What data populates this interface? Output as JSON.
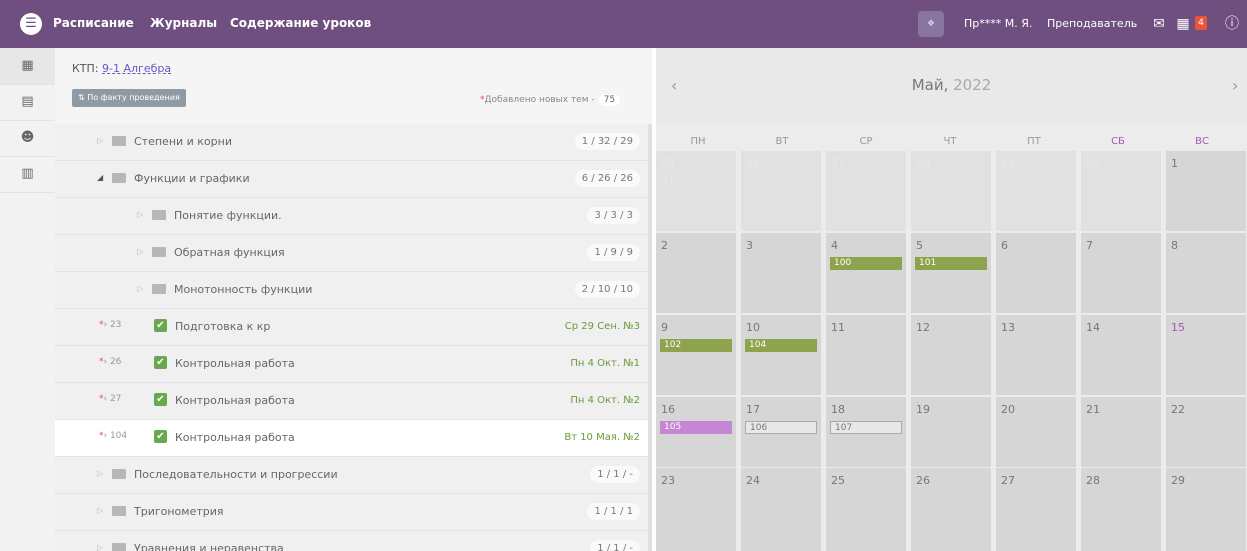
{
  "topbar": {
    "menu_icon": "hamburger-icon",
    "nav": [
      "Расписание",
      "Журналы",
      "Содержание уроков"
    ],
    "user_name": "Пр**** М. Я.",
    "user_role": "Преподаватель",
    "notifications_count": "4",
    "icons": [
      "mail-icon",
      "calendar-icon",
      "info-icon"
    ]
  },
  "siderail": {
    "icons": [
      "calendar-icon",
      "document-icon",
      "users-icon",
      "map-icon"
    ]
  },
  "left": {
    "ktp_label": "КТП:",
    "ktp_link": "9-1 Алгебра",
    "filter_button": "По факту проведения",
    "new_topics_star": "*",
    "new_topics_label": "Добавлено новых тем -",
    "new_topics_count": "75",
    "rows": [
      {
        "type": "folder",
        "level": 1,
        "expanded": false,
        "label": "Степени и корни",
        "stats": "1 / 32 / 29"
      },
      {
        "type": "folder",
        "level": 1,
        "expanded": true,
        "label": "Функции и графики",
        "stats": "6 / 26 / 26"
      },
      {
        "type": "folder",
        "level": 2,
        "expanded": false,
        "label": "Понятие функции.",
        "stats": "3 / 3 / 3"
      },
      {
        "type": "folder",
        "level": 2,
        "expanded": false,
        "label": "Обратная функция",
        "stats": "1 / 9 / 9"
      },
      {
        "type": "folder",
        "level": 2,
        "expanded": false,
        "label": "Монотонность функции",
        "stats": "2 / 10 / 10"
      },
      {
        "type": "lesson",
        "num": "23",
        "label": "Подготовка к кр",
        "date": "Ср 29 Сен. №3"
      },
      {
        "type": "lesson",
        "num": "26",
        "label": "Контрольная работа",
        "date": "Пн 4 Окт. №1"
      },
      {
        "type": "lesson",
        "num": "27",
        "label": "Контрольная работа",
        "date": "Пн 4 Окт. №2"
      },
      {
        "type": "lesson",
        "num": "104",
        "label": "Контрольная работа",
        "date": "Вт 10 Мая. №2",
        "selected": true
      },
      {
        "type": "folder",
        "level": 1,
        "expanded": false,
        "label": "Последовательности и прогрессии",
        "stats": "1 / 1 / -"
      },
      {
        "type": "folder",
        "level": 1,
        "expanded": false,
        "label": "Тригонометрия",
        "stats": "1 / 1 / 1"
      },
      {
        "type": "folder",
        "level": 1,
        "expanded": false,
        "label": "Уравнения и неравенства",
        "stats": "1 / 1 / -"
      }
    ]
  },
  "calendar": {
    "month": "Май,",
    "year": "2022",
    "weekdays": [
      "ПН",
      "ВТ",
      "СР",
      "ЧТ",
      "ПТ",
      "СБ",
      "ВС"
    ],
    "weeks": [
      [
        {
          "d": "25",
          "muted": true,
          "extra": "31"
        },
        {
          "d": "26",
          "muted": true
        },
        {
          "d": "27",
          "muted": true
        },
        {
          "d": "28",
          "muted": true
        },
        {
          "d": "29",
          "muted": true
        },
        {
          "d": "30",
          "muted": true
        },
        {
          "d": "1"
        }
      ],
      [
        {
          "d": "2"
        },
        {
          "d": "3"
        },
        {
          "d": "4",
          "lesson": "100",
          "style": "green"
        },
        {
          "d": "5",
          "lesson": "101",
          "style": "green"
        },
        {
          "d": "6"
        },
        {
          "d": "7"
        },
        {
          "d": "8"
        }
      ],
      [
        {
          "d": "9",
          "lesson": "102",
          "style": "green"
        },
        {
          "d": "10",
          "lesson": "104",
          "style": "green"
        },
        {
          "d": "11"
        },
        {
          "d": "12"
        },
        {
          "d": "13"
        },
        {
          "d": "14"
        },
        {
          "d": "15",
          "weekend": true
        }
      ],
      [
        {
          "d": "16",
          "lesson": "105",
          "style": "purple"
        },
        {
          "d": "17",
          "lesson": "106",
          "style": "gray"
        },
        {
          "d": "18",
          "lesson": "107",
          "style": "gray"
        },
        {
          "d": "19"
        },
        {
          "d": "20"
        },
        {
          "d": "21"
        },
        {
          "d": "22"
        }
      ],
      [
        {
          "d": "23"
        },
        {
          "d": "24"
        },
        {
          "d": "25"
        },
        {
          "d": "26"
        },
        {
          "d": "27"
        },
        {
          "d": "28"
        },
        {
          "d": "29"
        }
      ]
    ],
    "colors": {
      "green": "#8ea34e",
      "purple": "#c587d4",
      "weekend": "#a05bb0",
      "header": "#6e4f80"
    }
  }
}
